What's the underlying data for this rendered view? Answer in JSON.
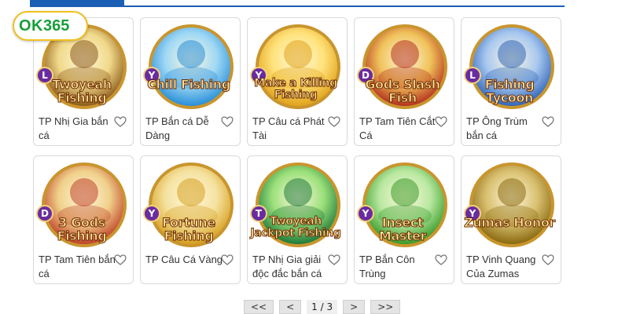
{
  "brand": {
    "logo_ok": "OK",
    "logo_num": "365"
  },
  "games": [
    {
      "caption": "TP Nhị Gia bắn cá",
      "badge": "L",
      "art_title": "Twoyeah Fishing",
      "theme": "#8b5a1a",
      "bg": "#f1d98a"
    },
    {
      "caption": "TP Bắn cá Dễ Dàng",
      "badge": "Y",
      "art_title": "Chill Fishing",
      "theme": "#2a8fd8",
      "bg": "#9fd8f5"
    },
    {
      "caption": "TP Câu cá Phát Tài",
      "badge": "Y",
      "art_title": "Make a Killing Fishing",
      "theme": "#e0a21a",
      "bg": "#ffe27a"
    },
    {
      "caption": "TP Tam Tiên Cắt Cá",
      "badge": "D",
      "art_title": "Gods Slash Fish",
      "theme": "#b5321e",
      "bg": "#f0c25a"
    },
    {
      "caption": "TP Ông Trùm bắn cá",
      "badge": "L",
      "art_title": "Fishing Tycoon",
      "theme": "#3266b8",
      "bg": "#a8c8f0"
    },
    {
      "caption": "TP Tam Tiên bắn cá",
      "badge": "D",
      "art_title": "3 Gods Fishing",
      "theme": "#c0432a",
      "bg": "#f0d08a"
    },
    {
      "caption": "TP Câu Cá Vàng",
      "badge": "Y",
      "art_title": "Fortune Fishing",
      "theme": "#d6a020",
      "bg": "#f5e2a0"
    },
    {
      "caption": "TP Nhị Gia giải độc đắc bắn cá",
      "badge": "T",
      "art_title": "Twoyeah Jackpot Fishing",
      "theme": "#1f7a3a",
      "bg": "#9be07a"
    },
    {
      "caption": "TP Bắn Côn Trùng",
      "badge": "Y",
      "art_title": "Insect Master",
      "theme": "#3a9a2a",
      "bg": "#b8e8a0"
    },
    {
      "caption": "TP Vinh Quang Của Zumas",
      "badge": "Y",
      "art_title": "Zumas Honor",
      "theme": "#8a6a10",
      "bg": "#d9c070"
    }
  ],
  "pagination": {
    "first": "<<",
    "prev": "<",
    "info": "1 / 3",
    "next": ">",
    "last": ">>"
  },
  "colors": {
    "accent": "#1a5fb4",
    "badge": "#6a2ba0",
    "logo_green": "#1a9e3a",
    "logo_ring": "#f0c020"
  },
  "icons": {
    "favorite": "heart-outline-icon"
  }
}
